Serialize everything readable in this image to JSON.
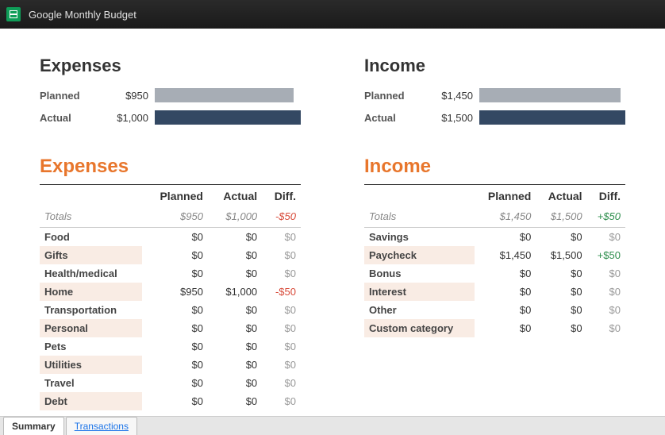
{
  "window": {
    "title": "Google Monthly Budget"
  },
  "expensesBar": {
    "title": "Expenses",
    "plannedLabel": "Planned",
    "plannedValue": "$950",
    "plannedPct": "95%",
    "actualLabel": "Actual",
    "actualValue": "$1,000",
    "actualPct": "100%"
  },
  "incomeBar": {
    "title": "Income",
    "plannedLabel": "Planned",
    "plannedValue": "$1,450",
    "plannedPct": "96.7%",
    "actualLabel": "Actual",
    "actualValue": "$1,500",
    "actualPct": "100%"
  },
  "expensesTable": {
    "title": "Expenses",
    "headers": {
      "planned": "Planned",
      "actual": "Actual",
      "diff": "Diff."
    },
    "totals": {
      "label": "Totals",
      "planned": "$950",
      "actual": "$1,000",
      "diff": "-$50",
      "diffSign": "neg"
    },
    "rows": [
      {
        "label": "Food",
        "planned": "$0",
        "actual": "$0",
        "diff": "$0",
        "diffSign": "zero"
      },
      {
        "label": "Gifts",
        "planned": "$0",
        "actual": "$0",
        "diff": "$0",
        "diffSign": "zero"
      },
      {
        "label": "Health/medical",
        "planned": "$0",
        "actual": "$0",
        "diff": "$0",
        "diffSign": "zero"
      },
      {
        "label": "Home",
        "planned": "$950",
        "actual": "$1,000",
        "diff": "-$50",
        "diffSign": "neg"
      },
      {
        "label": "Transportation",
        "planned": "$0",
        "actual": "$0",
        "diff": "$0",
        "diffSign": "zero"
      },
      {
        "label": "Personal",
        "planned": "$0",
        "actual": "$0",
        "diff": "$0",
        "diffSign": "zero"
      },
      {
        "label": "Pets",
        "planned": "$0",
        "actual": "$0",
        "diff": "$0",
        "diffSign": "zero"
      },
      {
        "label": "Utilities",
        "planned": "$0",
        "actual": "$0",
        "diff": "$0",
        "diffSign": "zero"
      },
      {
        "label": "Travel",
        "planned": "$0",
        "actual": "$0",
        "diff": "$0",
        "diffSign": "zero"
      },
      {
        "label": "Debt",
        "planned": "$0",
        "actual": "$0",
        "diff": "$0",
        "diffSign": "zero"
      }
    ]
  },
  "incomeTable": {
    "title": "Income",
    "headers": {
      "planned": "Planned",
      "actual": "Actual",
      "diff": "Diff."
    },
    "totals": {
      "label": "Totals",
      "planned": "$1,450",
      "actual": "$1,500",
      "diff": "+$50",
      "diffSign": "pos"
    },
    "rows": [
      {
        "label": "Savings",
        "planned": "$0",
        "actual": "$0",
        "diff": "$0",
        "diffSign": "zero"
      },
      {
        "label": "Paycheck",
        "planned": "$1,450",
        "actual": "$1,500",
        "diff": "+$50",
        "diffSign": "pos"
      },
      {
        "label": "Bonus",
        "planned": "$0",
        "actual": "$0",
        "diff": "$0",
        "diffSign": "zero"
      },
      {
        "label": "Interest",
        "planned": "$0",
        "actual": "$0",
        "diff": "$0",
        "diffSign": "zero"
      },
      {
        "label": "Other",
        "planned": "$0",
        "actual": "$0",
        "diff": "$0",
        "diffSign": "zero"
      },
      {
        "label": "Custom category",
        "planned": "$0",
        "actual": "$0",
        "diff": "$0",
        "diffSign": "zero"
      }
    ]
  },
  "tabs": {
    "summary": "Summary",
    "transactions": "Transactions"
  }
}
